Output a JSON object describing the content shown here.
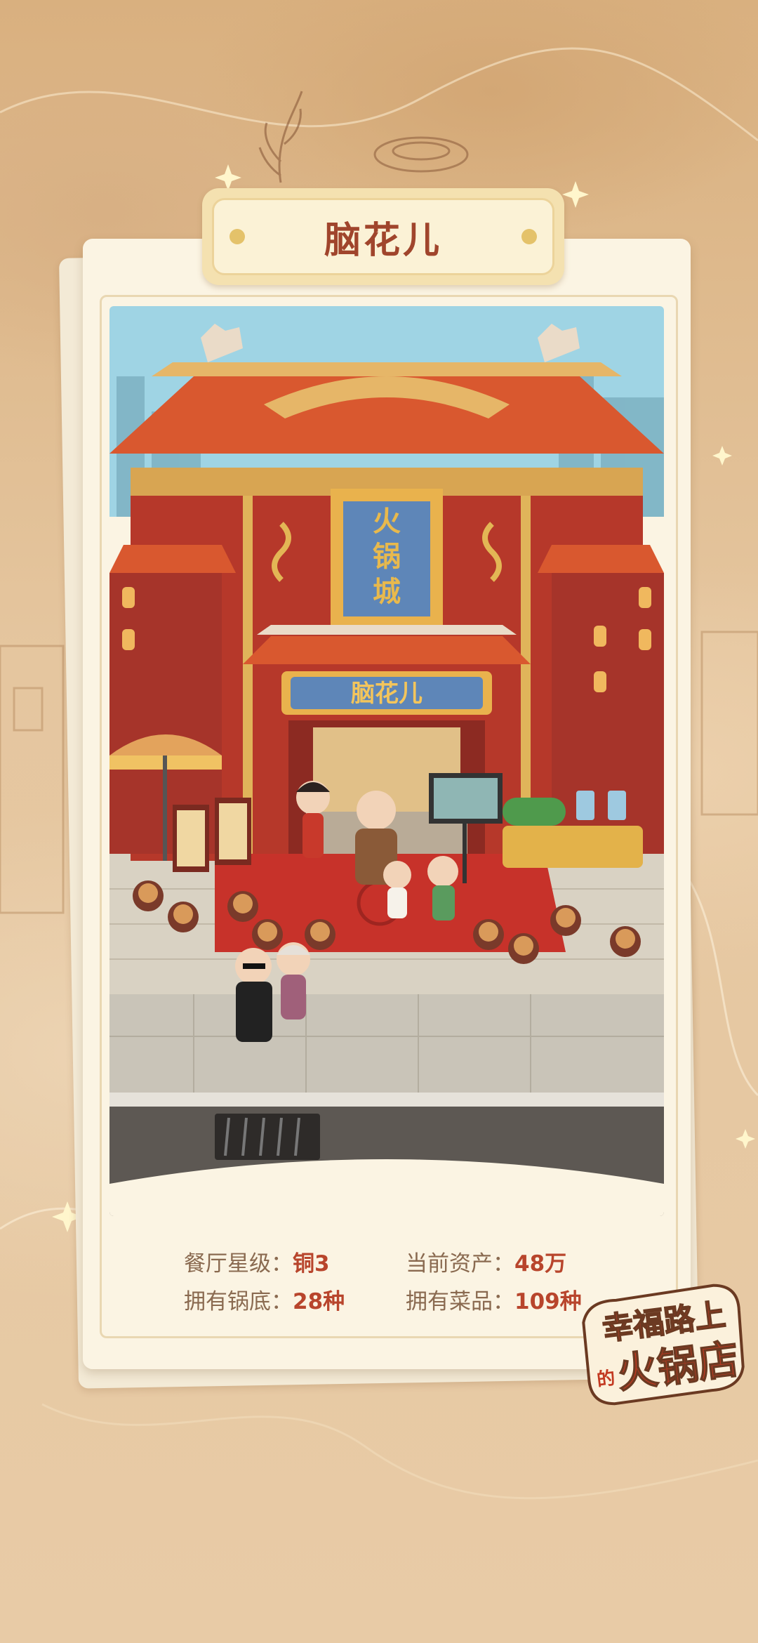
{
  "restaurant_name": "脑花儿",
  "scene": {
    "main_sign": "火锅城",
    "door_sign": "脑花儿"
  },
  "stats": {
    "star_label": "餐厅星级：",
    "star_value": "铜3",
    "assets_label": "当前资产：",
    "assets_value": "48万",
    "base_label": "拥有锅底：",
    "base_value": "28种",
    "dishes_label": "拥有菜品：",
    "dishes_value": "109种"
  },
  "logo": {
    "line1": "幸福路上",
    "small": "的",
    "line2": "火锅店"
  },
  "colors": {
    "background": "#e3c39b",
    "title_text": "#a0452c",
    "value_text": "#b8452c",
    "label_text": "#8a6a50",
    "paper": "#fbf4e3"
  }
}
